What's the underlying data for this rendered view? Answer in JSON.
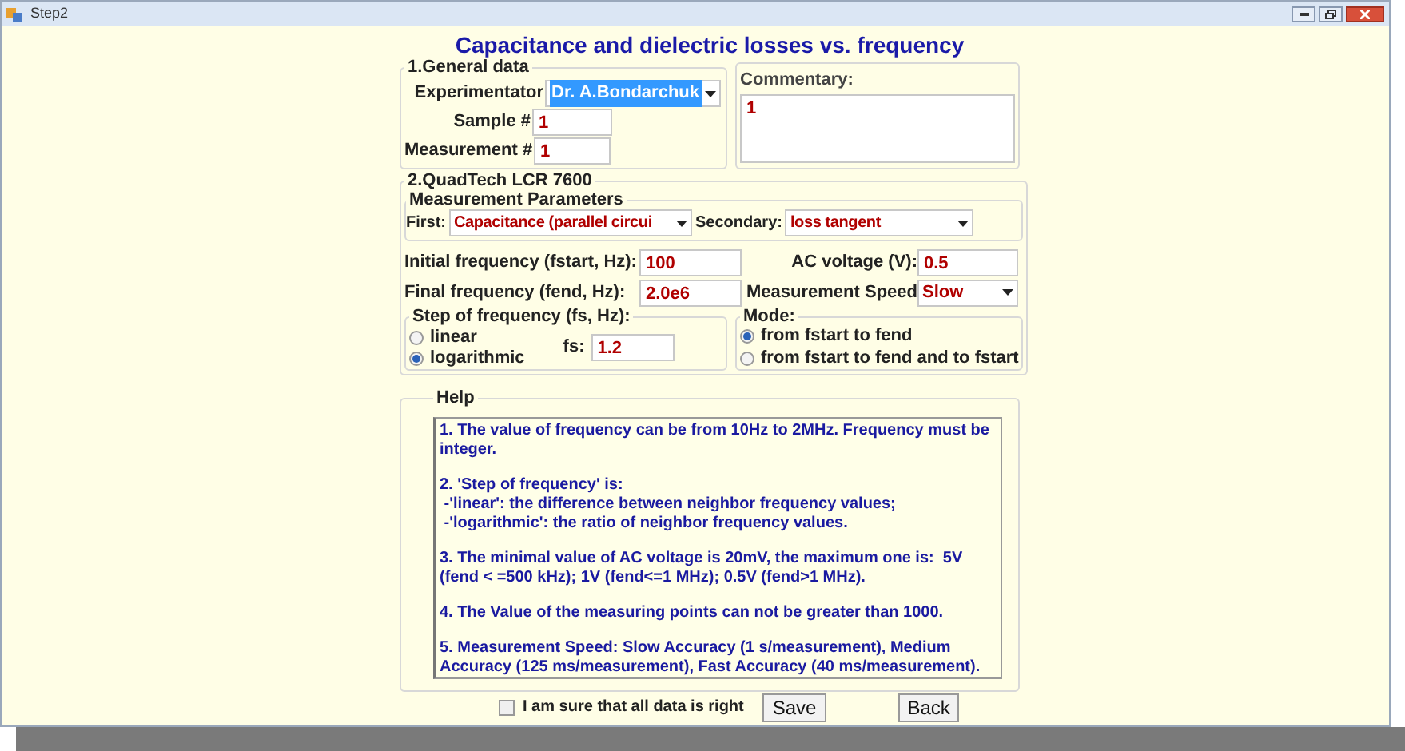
{
  "window": {
    "title": "Step2"
  },
  "heading": "Capacitance and dielectric losses vs. frequency",
  "general": {
    "title": "1.General data",
    "experimentator": {
      "label": "Experimentator",
      "value": "Dr. A.Bondarchuk",
      "highlighted": true
    },
    "sample": {
      "label": "Sample #",
      "value": "1"
    },
    "measurement": {
      "label": "Measurement #",
      "value": "1"
    }
  },
  "commentary": {
    "label": "Commentary:",
    "value": "1"
  },
  "lcr": {
    "title": "2.QuadTech LCR 7600",
    "params_title": "Measurement Parameters",
    "first": {
      "label": "First:",
      "value": "Capacitance (parallel circui"
    },
    "secondary": {
      "label": "Secondary:",
      "value": "loss tangent"
    },
    "initial": {
      "label": "Initial frequency (fstart, Hz):",
      "value": "100"
    },
    "final": {
      "label": "Final frequency (fend, Hz):",
      "value": "2.0e6"
    },
    "voltage": {
      "label": "AC voltage (V):",
      "value": "0.5"
    },
    "speed": {
      "label": "Measurement Speed",
      "value": "Slow"
    },
    "step": {
      "title": "Step of frequency (fs, Hz):",
      "options": [
        {
          "label": "linear",
          "selected": false
        },
        {
          "label": "logarithmic",
          "selected": true
        }
      ],
      "fs": {
        "label": "fs:",
        "value": "1.2"
      }
    },
    "mode": {
      "title": "Mode:",
      "options": [
        {
          "label": "from fstart to fend",
          "selected": true
        },
        {
          "label": "from fstart to fend and to fstart",
          "selected": false
        }
      ]
    }
  },
  "help": {
    "title": "Help",
    "paragraphs": [
      [
        "1. The value of frequency can be from 10Hz to 2MHz. Frequency must be integer."
      ],
      [
        "2. 'Step of frequency' is:",
        " -'linear': the difference between neighbor frequency values;",
        " -'logarithmic': the ratio of neighbor frequency values."
      ],
      [
        "3. The minimal value of AC voltage is 20mV, the maximum one is:  5V (fend < =500 kHz); 1V (fend<=1 MHz); 0.5V (fend>1 MHz)."
      ],
      [
        "4. The Value of the measuring points can not be greater than 1000."
      ],
      [
        "5. Measurement Speed: Slow Accuracy (1 s/measurement), Medium Accuracy (125 ms/measurement), Fast Accuracy (40 ms/measurement)."
      ]
    ]
  },
  "confirm": {
    "label": "I am sure that all data is right",
    "checked": false
  },
  "buttons": [
    "Save",
    "Back"
  ]
}
